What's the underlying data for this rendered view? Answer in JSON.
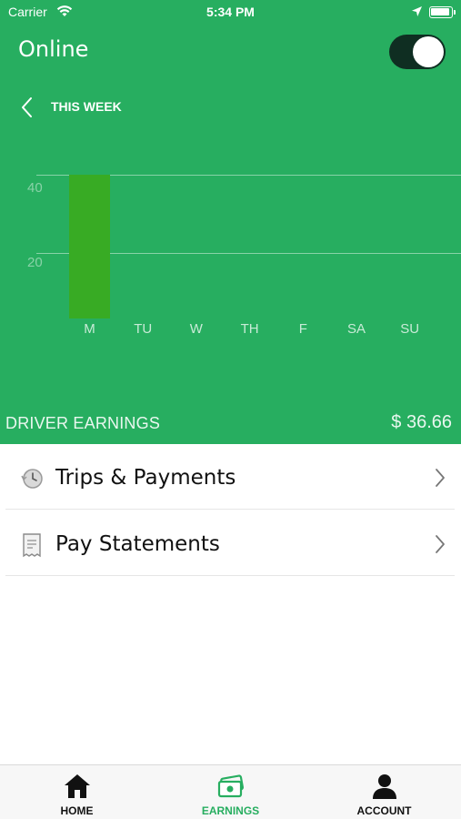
{
  "status_bar": {
    "carrier": "Carrier",
    "time": "5:34 PM"
  },
  "header": {
    "online_label": "Online",
    "online_toggle_on": true,
    "period_label": "THIS WEEK"
  },
  "chart_data": {
    "type": "bar",
    "categories": [
      "M",
      "TU",
      "W",
      "TH",
      "F",
      "SA",
      "SU"
    ],
    "values": [
      36.66,
      0,
      0,
      0,
      0,
      0,
      0
    ],
    "yticks": [
      "40",
      "20"
    ],
    "ylim": [
      0,
      60
    ],
    "grid": true,
    "bar_color": "#38ab24"
  },
  "summary": {
    "label": "DRIVER EARNINGS",
    "value": "$ 36.66"
  },
  "menu": {
    "items": [
      {
        "label": "Trips & Payments",
        "icon": "history-icon"
      },
      {
        "label": "Pay Statements",
        "icon": "receipt-icon"
      }
    ]
  },
  "tabs": [
    {
      "label": "HOME",
      "icon": "home-icon",
      "active": false
    },
    {
      "label": "EARNINGS",
      "icon": "money-icon",
      "active": true
    },
    {
      "label": "ACCOUNT",
      "icon": "person-icon",
      "active": false
    }
  ],
  "colors": {
    "brand_green": "#27ae60",
    "active_tab": "#27ae60",
    "inactive_tab": "#111111"
  }
}
